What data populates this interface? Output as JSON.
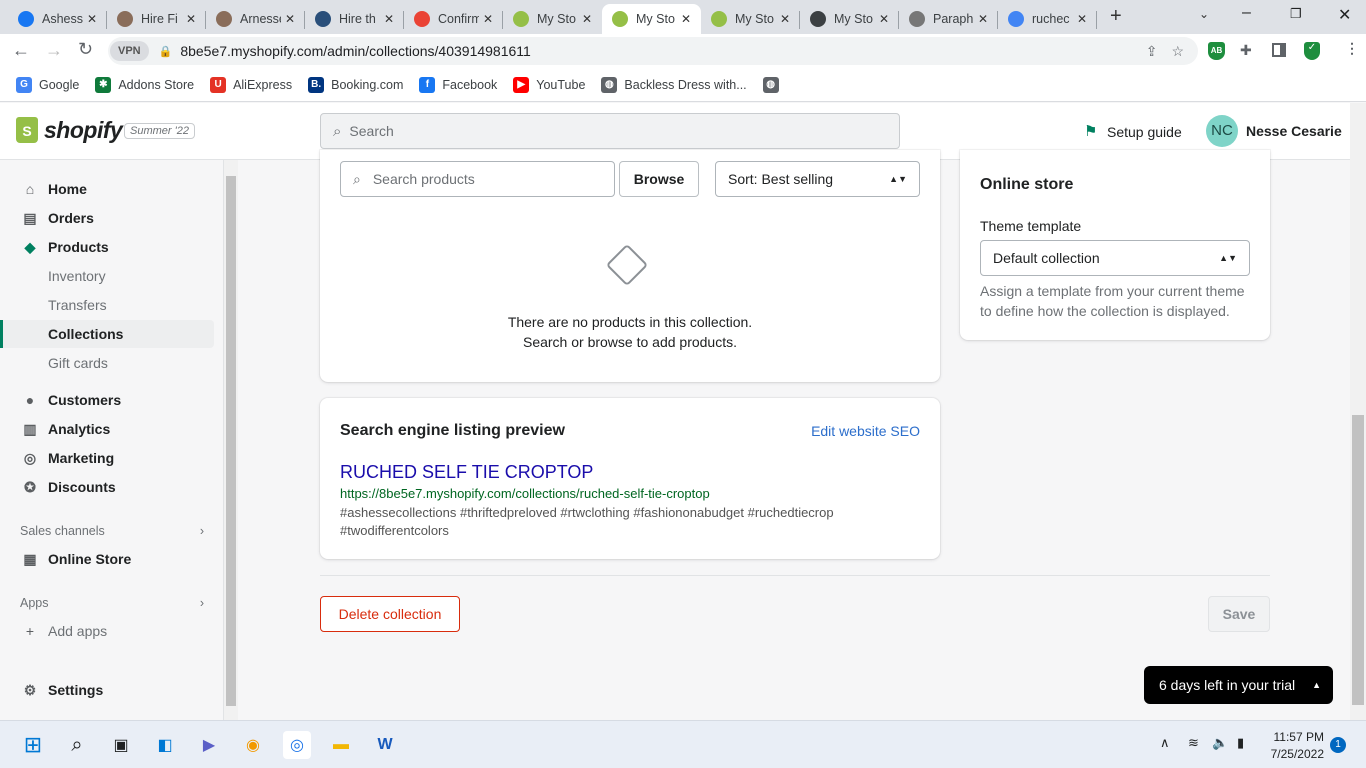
{
  "browser": {
    "tabs": [
      {
        "title": "Ashesse",
        "icon": "facebook-icon",
        "color": "#1877f2"
      },
      {
        "title": "Hire Fi",
        "icon": "profile-photo-icon",
        "color": "#8a6d5a"
      },
      {
        "title": "Arnesse",
        "icon": "profile-photo-icon",
        "color": "#8a6d5a"
      },
      {
        "title": "Hire th",
        "icon": "globe-icon",
        "color": "#2a4f7a"
      },
      {
        "title": "Confirm",
        "icon": "gmail-icon",
        "color": "#ea4335"
      },
      {
        "title": "My Sto",
        "icon": "shopify-icon",
        "color": "#95bf47"
      },
      {
        "title": "My Sto",
        "icon": "shopify-icon",
        "color": "#95bf47"
      },
      {
        "title": "My Sto",
        "icon": "shopify-icon",
        "color": "#95bf47"
      },
      {
        "title": "My Sto",
        "icon": "globe-icon",
        "color": "#3c4043"
      },
      {
        "title": "Paraph",
        "icon": "quill-icon",
        "color": "#777"
      },
      {
        "title": "ruchec",
        "icon": "google-icon",
        "color": "#4285f4"
      }
    ],
    "active_tab": 6,
    "vpn_label": "VPN",
    "url": "8be5e7.myshopify.com/admin/collections/403914981611",
    "extension_label": "AB",
    "bookmarks": [
      {
        "label": "Google",
        "icon": "google-icon",
        "color": "#4285f4",
        "g": "G"
      },
      {
        "label": "Addons Store",
        "icon": "addons-icon",
        "color": "#0f7a3b",
        "g": "✱"
      },
      {
        "label": "AliExpress",
        "icon": "aliexpress-icon",
        "color": "#e43225",
        "g": "U"
      },
      {
        "label": "Booking.com",
        "icon": "booking-icon",
        "color": "#003580",
        "g": "B."
      },
      {
        "label": "Facebook",
        "icon": "facebook-icon",
        "color": "#1877f2",
        "g": "f"
      },
      {
        "label": "YouTube",
        "icon": "youtube-icon",
        "color": "#ff0000",
        "g": "▶"
      },
      {
        "label": "Backless Dress with...",
        "icon": "globe-icon",
        "color": "#5f6368",
        "g": "◍"
      },
      {
        "label": "",
        "icon": "globe-icon",
        "color": "#5f6368",
        "g": "◍"
      }
    ]
  },
  "header": {
    "logo": "shopify",
    "edition": "Summer '22",
    "search_placeholder": "Search",
    "setup_guide": "Setup guide",
    "avatar_initials": "NC",
    "user_name": "Nesse Cesarie"
  },
  "sidebar": {
    "items": [
      {
        "label": "Home",
        "icon": "home-icon",
        "g": "⌂"
      },
      {
        "label": "Orders",
        "icon": "orders-icon",
        "g": "▤"
      },
      {
        "label": "Products",
        "icon": "tag-icon",
        "g": "◆"
      },
      {
        "label": "Inventory"
      },
      {
        "label": "Transfers"
      },
      {
        "label": "Collections"
      },
      {
        "label": "Gift cards"
      },
      {
        "label": "Customers",
        "icon": "person-icon",
        "g": "●"
      },
      {
        "label": "Analytics",
        "icon": "analytics-icon",
        "g": "▥"
      },
      {
        "label": "Marketing",
        "icon": "marketing-icon",
        "g": "◎"
      },
      {
        "label": "Discounts",
        "icon": "discount-icon",
        "g": "✪"
      }
    ],
    "sales_channels_label": "Sales channels",
    "online_store": "Online Store",
    "apps_label": "Apps",
    "add_apps": "Add apps",
    "settings": "Settings"
  },
  "products_card": {
    "search_placeholder": "Search products",
    "browse": "Browse",
    "sort": "Sort: Best selling",
    "empty_line1": "There are no products in this collection.",
    "empty_line2": "Search or browse to add products."
  },
  "seo_card": {
    "title": "Search engine listing preview",
    "edit_link": "Edit website SEO",
    "page_title": "RUCHED SELF TIE CROPTOP",
    "url": "https://8be5e7.myshopify.com/collections/ruched-self-tie-croptop",
    "description": "#ashessecollections #thriftedpreloved #rtwclothing #fashiononabudget #ruchedtiecrop #twodifferentcolors"
  },
  "online_store_card": {
    "title": "Online store",
    "theme_label": "Theme template",
    "theme_value": "Default collection",
    "help": "Assign a template from your current theme to define how the collection is displayed."
  },
  "actions": {
    "delete": "Delete collection",
    "save": "Save"
  },
  "trial_banner": "6 days left in your trial",
  "taskbar": {
    "time": "11:57 PM",
    "date": "7/25/2022",
    "notifications": "1"
  },
  "colors": {
    "accent": "#008060",
    "critical": "#d82c0d",
    "link": "#2c6ecb",
    "seo_title": "#1a0dab"
  }
}
